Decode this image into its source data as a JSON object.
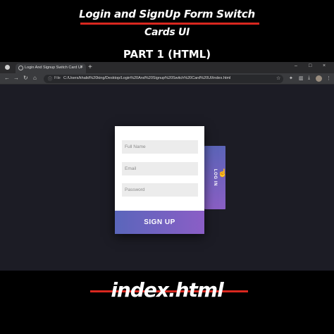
{
  "overlay": {
    "title_line1": "Login and SignUp Form Switch",
    "title_line2": "Cards UI",
    "part_label": "PART 1 (HTML)",
    "caption": "index.html",
    "accent_color": "#d9271f"
  },
  "browser": {
    "tab_title": "Login And Signup Switch Card UI",
    "tab_close": "×",
    "new_tab": "+",
    "window_controls": [
      "–",
      "□",
      "×"
    ],
    "nav": {
      "back": "←",
      "forward": "→",
      "reload": "↻",
      "home": "⌂"
    },
    "url_label": "File",
    "url": "C:/Users/khalid%20king/Desktop/Login%20And%20Signup%20Switch%20Card%20UI/index.html",
    "toolbar_icons": [
      "star-icon",
      "extensions-icon",
      "sidebar-icon",
      "menu-icon"
    ]
  },
  "form": {
    "full_name_placeholder": "Full Name",
    "email_placeholder": "Email",
    "password_placeholder": "Password",
    "signup_label": "SIGN UP",
    "login_label": "LOG IN",
    "gradient_start": "#5a66bb",
    "gradient_end": "#8b5ec6"
  }
}
